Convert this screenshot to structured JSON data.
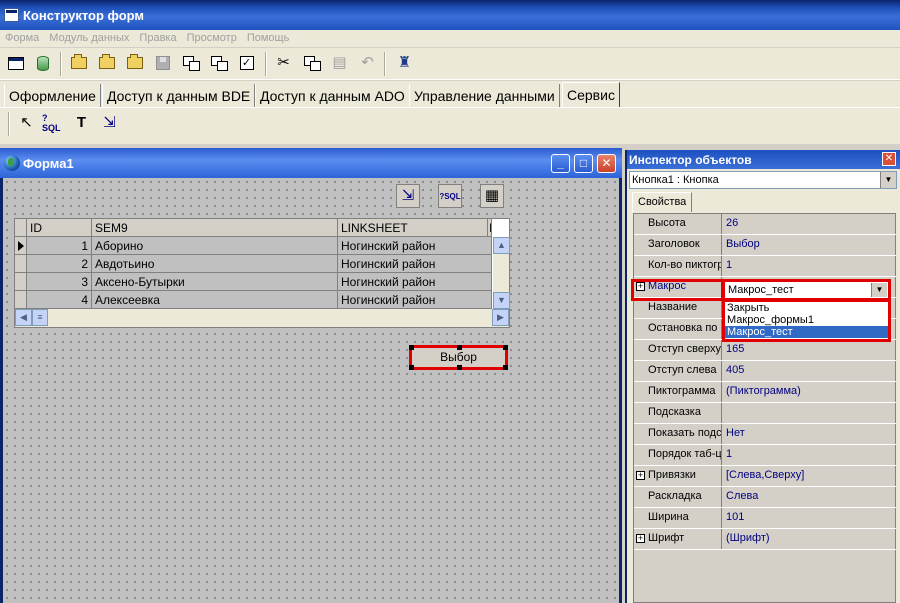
{
  "app": {
    "title": "Конструктор форм"
  },
  "menu": [
    "Форма",
    "Модуль данных",
    "Правка",
    "Просмотр",
    "Помощь"
  ],
  "toolbar": {
    "icons": [
      "new-form-icon",
      "data-module-icon",
      "open-icon",
      "open-icon",
      "open-module-icon",
      "save-icon",
      "copy-form-icon",
      "check-icon",
      "cut-icon",
      "copy-icon",
      "paste-icon",
      "undo-icon",
      "run-icon"
    ]
  },
  "palette_tabs": [
    "Оформление",
    "Доступ к данным BDE",
    "Доступ к данным ADO",
    "Управление данными",
    "Сервис"
  ],
  "palette_active_tab": "Сервис",
  "form": {
    "title": "Форма1",
    "grid": {
      "columns": [
        "ID",
        "SEM9",
        "LINKSHEET",
        "I"
      ],
      "rows": [
        [
          "1",
          "Аборино",
          "Ногинский район"
        ],
        [
          "2",
          "Авдотьино",
          "Ногинский район"
        ],
        [
          "3",
          "Аксено-Бутырки",
          "Ногинский район"
        ],
        [
          "4",
          "Алексеевка",
          "Ногинский район"
        ]
      ]
    },
    "button_label": "Выбор"
  },
  "inspector": {
    "title": "Инспектор объектов",
    "selected_object": "Кнопка1 : Кнопка",
    "tab": "Свойства",
    "properties": [
      {
        "name": "Высота",
        "value": "26"
      },
      {
        "name": "Заголовок",
        "value": "Выбор"
      },
      {
        "name": "Кол-во пиктогр",
        "value": "1"
      },
      {
        "name": "Макрос",
        "value": "Макрос_тест",
        "expandable": true
      },
      {
        "name": "Название",
        "value": ""
      },
      {
        "name": "Остановка по",
        "value": ""
      },
      {
        "name": "Отступ сверху",
        "value": "165"
      },
      {
        "name": "Отступ слева",
        "value": "405"
      },
      {
        "name": "Пиктограмма",
        "value": "(Пиктограмма)"
      },
      {
        "name": "Подсказка",
        "value": ""
      },
      {
        "name": "Показать подс",
        "value": "Нет"
      },
      {
        "name": "Порядок таб-ц",
        "value": "1"
      },
      {
        "name": "Привязки",
        "value": "[Слева,Сверху]",
        "expandable": true
      },
      {
        "name": "Раскладка",
        "value": "Слева"
      },
      {
        "name": "Ширина",
        "value": "101"
      },
      {
        "name": "Шрифт",
        "value": "(Шрифт)",
        "expandable": true
      }
    ],
    "macro_options": [
      "Закрыть",
      "Макрос_формы1",
      "Макрос_тест"
    ],
    "macro_selected": "Макрос_тест"
  },
  "colors": {
    "highlight": "#e00000",
    "selection": "#316ac5",
    "title_blue": "#0a246a"
  }
}
